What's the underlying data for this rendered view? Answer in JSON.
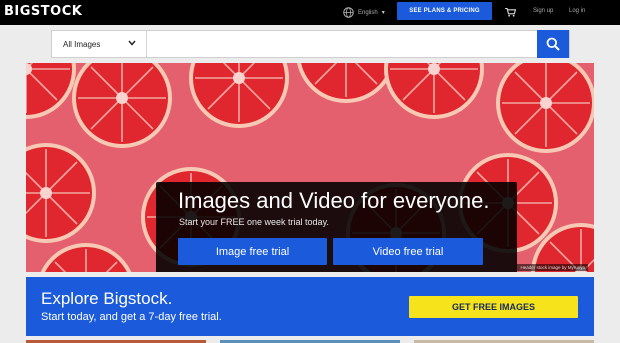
{
  "header": {
    "logo_text": "BIGSTOCK",
    "language_label": "English",
    "plans_label": "SEE PLANS & PRICING",
    "signup_label": "Sign up",
    "login_label": "Log in"
  },
  "search": {
    "category_selected": "All Images",
    "placeholder": ""
  },
  "hero": {
    "title": "Images and Video for everyone.",
    "subtitle": "Start your FREE one week trial today.",
    "image_trial_label": "Image free trial",
    "video_trial_label": "Video free trial",
    "credit": "Header stock image by Myrunya"
  },
  "promo": {
    "title": "Explore Bigstock.",
    "subtitle": "Start today, and get a 7-day free trial.",
    "cta_label": "GET FREE IMAGES"
  },
  "icons": [
    "globe-icon",
    "cart-icon",
    "search-icon",
    "chevron-down-icon"
  ],
  "colors": {
    "accent_blue": "#1a5adb",
    "cta_yellow": "#f7e31b",
    "hero_pink": "#e4606e",
    "fruit_red": "#e0262e",
    "topbar_black": "#000000"
  }
}
